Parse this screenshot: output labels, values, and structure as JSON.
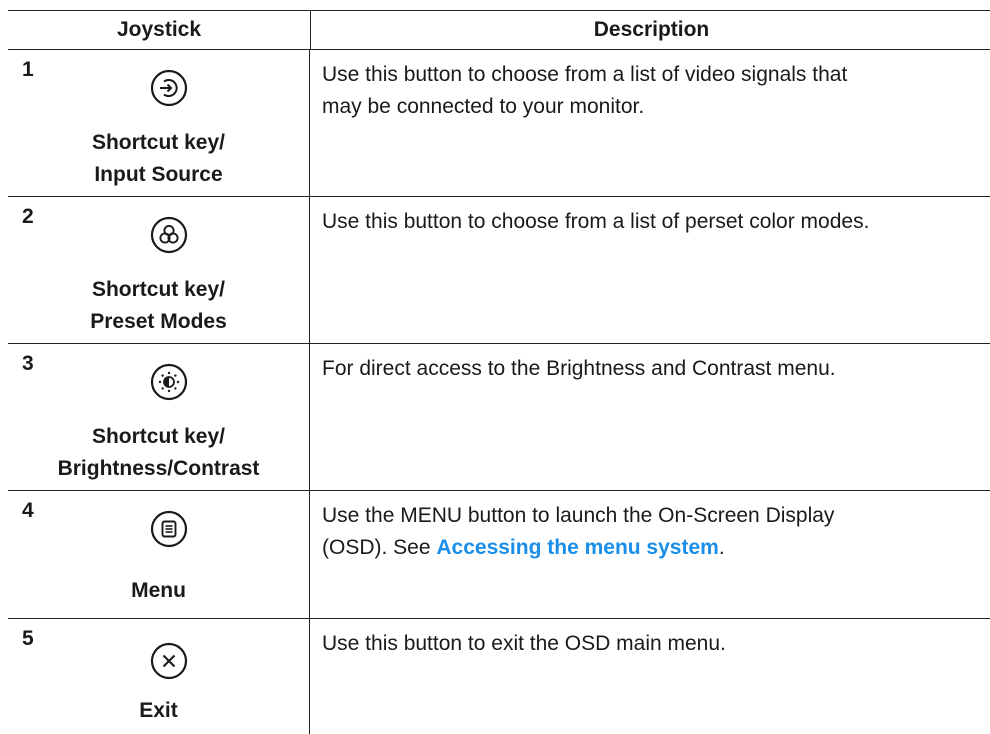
{
  "header": {
    "col1": "Joystick",
    "col2": "Description"
  },
  "rows": [
    {
      "num": "1",
      "icon": "input-source-icon",
      "label_line1": "Shortcut key/",
      "label_line2": "Input Source",
      "desc_line1": "Use this button to choose from a list of video signals that",
      "desc_line2": "may be connected to your monitor."
    },
    {
      "num": "2",
      "icon": "preset-modes-icon",
      "label_line1": "Shortcut key/",
      "label_line2": "Preset Modes",
      "desc_line1": "Use this button to choose from a list of perset color modes."
    },
    {
      "num": "3",
      "icon": "brightness-contrast-icon",
      "label_line1": "Shortcut key/",
      "label_line2": "Brightness/Contrast",
      "desc_line1": "For direct access to the Brightness and Contrast menu."
    },
    {
      "num": "4",
      "icon": "menu-icon",
      "label_line1": "Menu",
      "desc_line1": "Use the MENU button to launch the On-Screen Display",
      "desc_line2_pre": "(OSD). See ",
      "desc_link": "Accessing the menu system",
      "desc_line2_post": "."
    },
    {
      "num": "5",
      "icon": "close-icon",
      "label_line1": "Exit",
      "desc_line1": "Use this button to exit the OSD main menu."
    }
  ],
  "colors": {
    "link": "#1a8ee8",
    "rule": "#222222"
  }
}
